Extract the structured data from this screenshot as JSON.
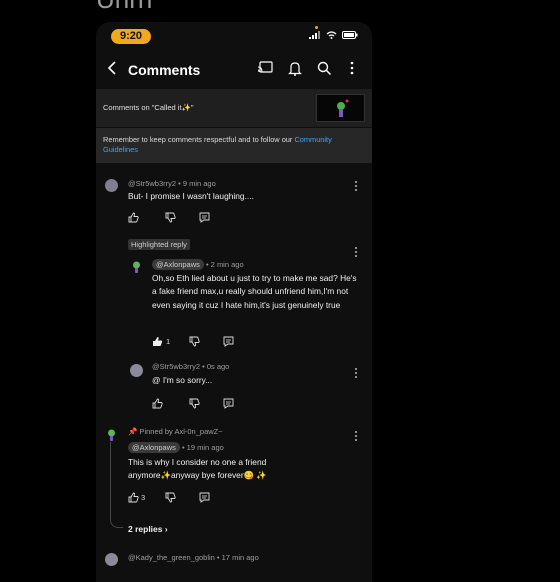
{
  "background": {
    "title_fragment": "Unrn"
  },
  "status": {
    "time": "9:20",
    "accent": "#f0a81d"
  },
  "appbar": {
    "title": "Comments",
    "icons": [
      "back-arrow-icon",
      "cast-icon",
      "bell-icon",
      "search-icon",
      "more-vertical-icon"
    ]
  },
  "video": {
    "label": "Comments on \"Called it✨\""
  },
  "guidelines": {
    "text": "Remember to keep comments respectful and to follow our ",
    "link": "Community Guidelines",
    "link_color": "#3ea6ff"
  },
  "comments": [
    {
      "author_meta": "@Str5wb3rry2 • 9 min ago",
      "text": "But- I promise I wasn't laughing....",
      "likes": ""
    },
    {
      "highlight_label": "Highlighted reply",
      "handle": "@Axlonpaws",
      "time": " • 2 min ago",
      "text": "Oh,so Eth lied about u just to try to make me sad? He's a fake friend max,u really should unfriend him,I'm not even saying it cuz I hate him,it's just genuinely true",
      "likes": "1"
    },
    {
      "author_meta": "@Str5wb3rry2 • 0s ago",
      "text": "@ I'm so sorry...",
      "likes": ""
    },
    {
      "pinned_label": "Pinned by Axl-0n_pawZ~",
      "handle": "@Axlonpaws",
      "time": " • 19 min ago",
      "text": "This is why I consider no one a friend anymore✨anyway bye forever😋 ✨",
      "likes": "3"
    }
  ],
  "replies_label": "2 replies",
  "next_comment_meta": "@Kady_the_green_goblin • 17 min ago"
}
